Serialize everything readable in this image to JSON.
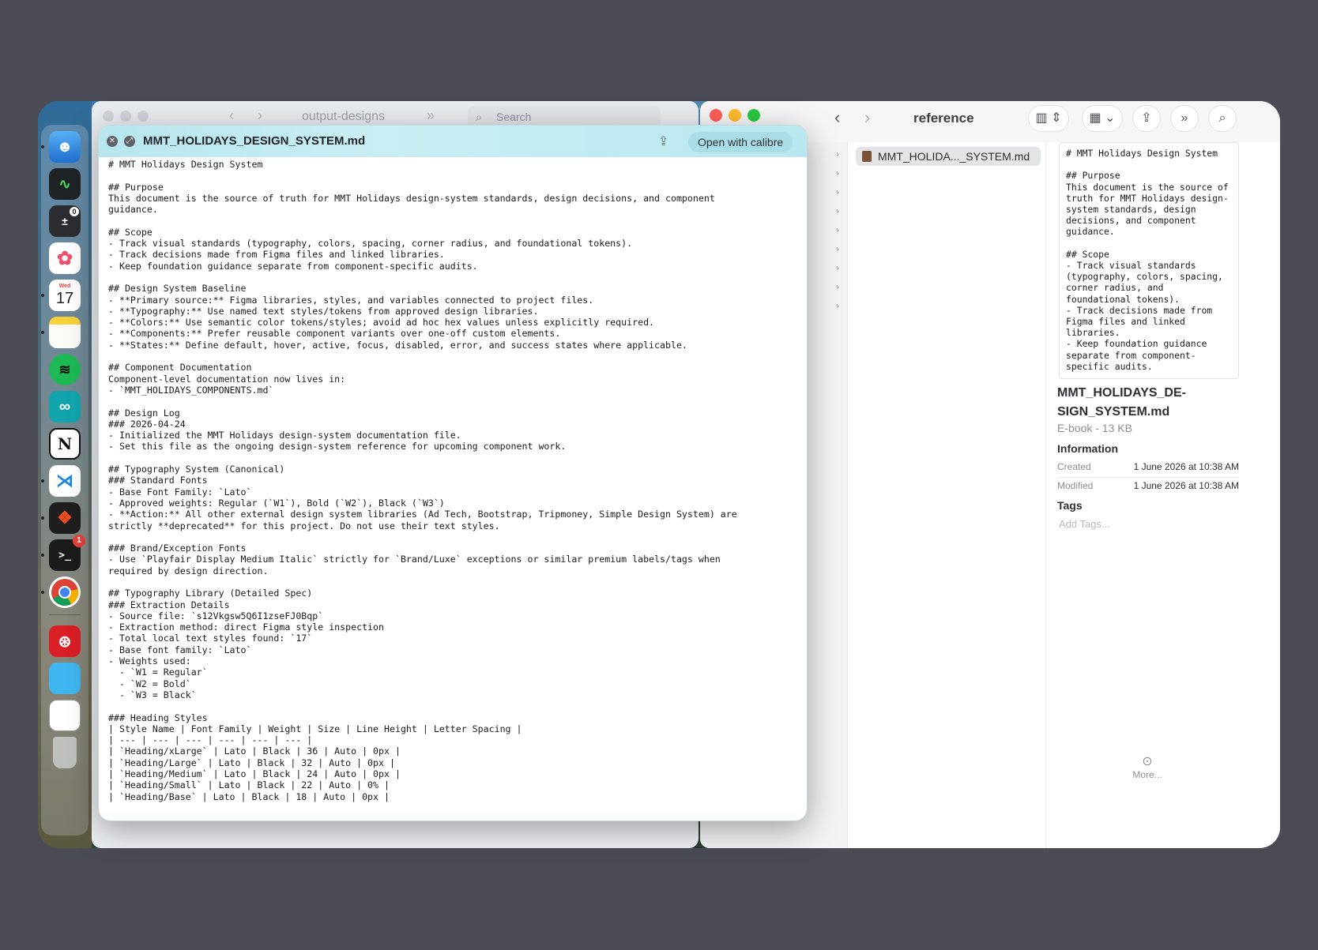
{
  "back_window": {
    "title": "output-designs",
    "search_placeholder": "Search"
  },
  "quicklook": {
    "title": "MMT_HOLIDAYS_DESIGN_SYSTEM.md",
    "open_button": "Open with calibre",
    "content": "# MMT Holidays Design System\n\n## Purpose\nThis document is the source of truth for MMT Holidays design-system standards, design decisions, and component\nguidance.\n\n## Scope\n- Track visual standards (typography, colors, spacing, corner radius, and foundational tokens).\n- Track decisions made from Figma files and linked libraries.\n- Keep foundation guidance separate from component-specific audits.\n\n## Design System Baseline\n- **Primary source:** Figma libraries, styles, and variables connected to project files.\n- **Typography:** Use named text styles/tokens from approved design libraries.\n- **Colors:** Use semantic color tokens/styles; avoid ad hoc hex values unless explicitly required.\n- **Components:** Prefer reusable component variants over one-off custom elements.\n- **States:** Define default, hover, active, focus, disabled, error, and success states where applicable.\n\n## Component Documentation\nComponent-level documentation now lives in:\n- `MMT_HOLIDAYS_COMPONENTS.md`\n\n## Design Log\n### 2026-04-24\n- Initialized the MMT Holidays design-system documentation file.\n- Set this file as the ongoing design-system reference for upcoming component work.\n\n## Typography System (Canonical)\n### Standard Fonts\n- Base Font Family: `Lato`\n- Approved weights: Regular (`W1`), Bold (`W2`), Black (`W3`)\n- **Action:** All other external design system libraries (Ad Tech, Bootstrap, Tripmoney, Simple Design System) are\nstrictly **deprecated** for this project. Do not use their text styles.\n\n### Brand/Exception Fonts\n- Use `Playfair Display Medium Italic` strictly for `Brand/Luxe` exceptions or similar premium labels/tags when\nrequired by design direction.\n\n## Typography Library (Detailed Spec)\n### Extraction Details\n- Source file: `s12Vkgsw5Q6I1zseFJ0Bqp`\n- Extraction method: direct Figma style inspection\n- Total local text styles found: `17`\n- Base font family: `Lato`\n- Weights used:\n  - `W1 = Regular`\n  - `W2 = Bold`\n  - `W3 = Black`\n\n### Heading Styles\n| Style Name | Font Family | Weight | Size | Line Height | Letter Spacing |\n| --- | --- | --- | --- | --- | --- |\n| `Heading/xLarge` | Lato | Black | 36 | Auto | 0px |\n| `Heading/Large` | Lato | Black | 32 | Auto | 0px |\n| `Heading/Medium` | Lato | Black | 24 | Auto | 0px |\n| `Heading/Small` | Lato | Black | 22 | Auto | 0% |\n| `Heading/Base` | Lato | Black | 18 | Auto | 0px |"
  },
  "finder": {
    "title": "reference",
    "file_item": "MMT_HOLIDA..._SYSTEM.md",
    "preview_text": "# MMT Holidays Design System\n\n## Purpose\nThis document is the source of\ntruth for MMT Holidays design-\nsystem standards, design\ndecisions, and component\nguidance.\n\n## Scope\n- Track visual standards\n(typography, colors, spacing,\ncorner radius, and\nfoundational tokens).\n- Track decisions made from\nFigma files and linked\nlibraries.\n- Keep foundation guidance\nseparate from component-\nspecific audits.\n\n## Design System Baseline",
    "file_name_line1": "MMT_HOLIDAYS_DE-",
    "file_name_line2": "SIGN_SYSTEM.md",
    "file_kind": "E-book - 13 KB",
    "info_heading": "Information",
    "created_label": "Created",
    "created_value": "1 June 2026 at 10:38 AM",
    "modified_label": "Modified",
    "modified_value": "1 June 2026 at 10:38 AM",
    "tags_heading": "Tags",
    "tags_placeholder": "Add Tags...",
    "more_label": "More..."
  },
  "dock": {
    "calendar_day": "Wed",
    "calendar_date": "17",
    "terminal_badge": "1",
    "activity_badge": "0",
    "icons": [
      "finder-icon",
      "activity-monitor-icon",
      "calculator-icon",
      "photos-icon",
      "calendar-icon",
      "notes-icon",
      "spotify-icon",
      "arduino-icon",
      "notion-icon",
      "vscode-icon",
      "figma-icon",
      "terminal-icon",
      "chrome-icon",
      "creative-cloud-icon",
      "folder-icon",
      "preview-document-icon",
      "trash-icon"
    ]
  },
  "colors": {
    "desktop_frame": "#4a4b55",
    "quicklook_header": "#b7e6ef",
    "close_red": "#fe5f57",
    "minimize_yellow": "#febc2e",
    "zoom_green": "#28c840"
  }
}
